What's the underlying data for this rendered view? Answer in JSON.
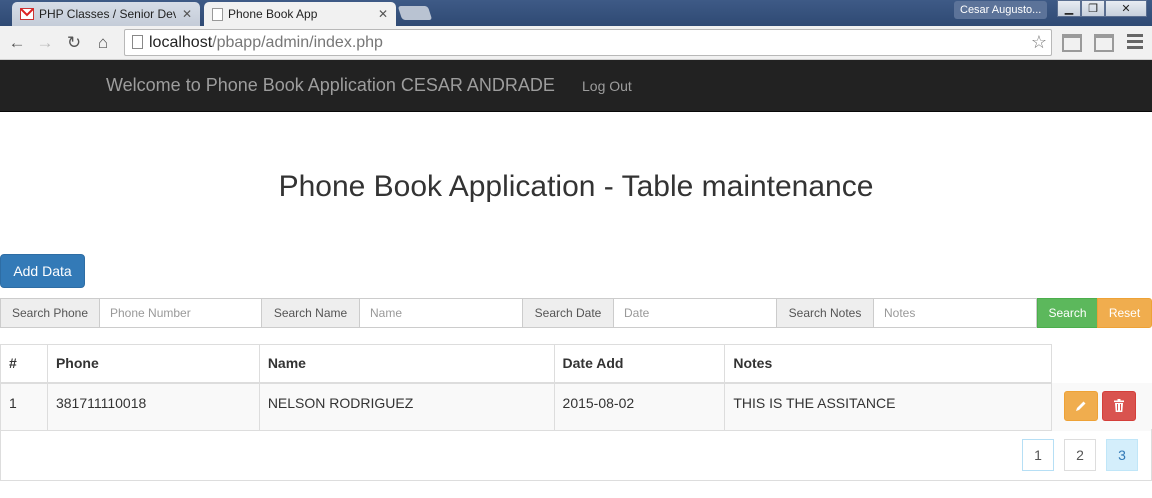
{
  "browser": {
    "tabs": [
      {
        "title": "PHP Classes / Senior Develop",
        "active": false
      },
      {
        "title": "Phone Book App",
        "active": true
      }
    ],
    "user_name": "Cesar Augusto...",
    "url_host": "localhost",
    "url_path": "/pbapp/admin/index.php"
  },
  "navbar": {
    "brand": "Welcome to Phone Book Application CESAR ANDRADE",
    "logout": "Log Out"
  },
  "page": {
    "title": "Phone Book Application - Table maintenance",
    "add_button": "Add Data"
  },
  "search": {
    "phone_label": "Search Phone",
    "phone_placeholder": "Phone Number",
    "name_label": "Search Name",
    "name_placeholder": "Name",
    "date_label": "Search Date",
    "date_placeholder": "Date",
    "notes_label": "Search Notes",
    "notes_placeholder": "Notes",
    "search_button": "Search",
    "reset_button": "Reset"
  },
  "table": {
    "headers": [
      "#",
      "Phone",
      "Name",
      "Date Add",
      "Notes"
    ],
    "rows": [
      {
        "num": "1",
        "phone": "381711110018",
        "name": "NELSON RODRIGUEZ",
        "date": "2015-08-02",
        "notes": "THIS IS THE ASSITANCE"
      }
    ]
  },
  "pagination": {
    "pages": [
      "1",
      "2",
      "3"
    ],
    "active": "3"
  },
  "colors": {
    "navbar_bg": "#222222",
    "primary": "#337ab7",
    "success": "#5cb85c",
    "warning": "#f0ad4e",
    "danger": "#d9534f"
  },
  "icons": {
    "edit": "pencil-icon",
    "delete": "trash-icon"
  }
}
